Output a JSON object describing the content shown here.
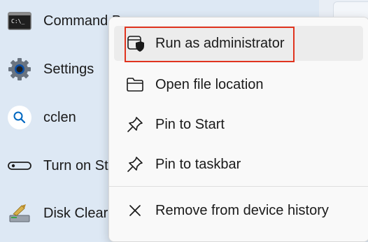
{
  "results": {
    "items": [
      {
        "label": "Command P",
        "icon": "command-prompt-icon"
      },
      {
        "label": "Settings",
        "icon": "gear-icon"
      },
      {
        "label": "cclen",
        "icon": "search-icon"
      },
      {
        "label": "Turn on St",
        "icon": "toggle-icon"
      },
      {
        "label": "Disk Clear",
        "icon": "disk-cleanup-icon"
      }
    ]
  },
  "context_menu": {
    "items": [
      {
        "label": "Run as administrator",
        "icon": "shield-window-icon"
      },
      {
        "label": "Open file location",
        "icon": "folder-icon"
      },
      {
        "label": "Pin to Start",
        "icon": "pin-icon"
      },
      {
        "label": "Pin to taskbar",
        "icon": "pin-icon"
      },
      {
        "label": "Remove from device history",
        "icon": "close-icon"
      }
    ],
    "highlighted_item": "Run as administrator",
    "highlight_color": "#e0341f"
  },
  "colors": {
    "background": "#dde8f4",
    "menu_background": "#f9f9f9",
    "accent_blue": "#0067c0"
  }
}
